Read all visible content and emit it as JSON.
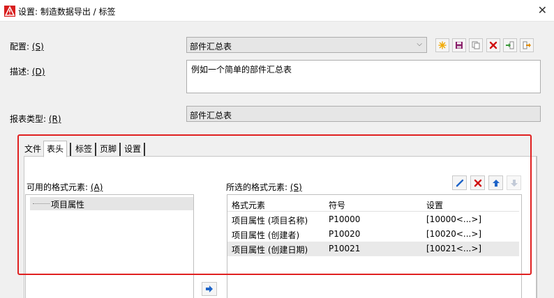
{
  "window": {
    "title": "设置: 制造数据导出 / 标签",
    "close": "✕"
  },
  "config": {
    "label": "配置: ",
    "shortcut": "(S)",
    "value": "部件汇总表",
    "arrow": "⌵"
  },
  "description": {
    "label": "描述: ",
    "shortcut": "(D)",
    "value": "例如一个简单的部件汇总表"
  },
  "report_type": {
    "label": "报表类型: ",
    "shortcut": "(R)",
    "value": "部件汇总表"
  },
  "toolbar": {
    "icons": [
      "new-icon",
      "save-icon",
      "copy-icon",
      "delete-icon",
      "import-icon",
      "export-icon"
    ]
  },
  "tabs": [
    {
      "label": "文件"
    },
    {
      "label": "表头"
    },
    {
      "label": "标签"
    },
    {
      "label": "页脚"
    },
    {
      "label": "设置"
    }
  ],
  "available": {
    "label": "可用的格式元素: ",
    "shortcut": "(A)",
    "items": [
      "项目属性"
    ]
  },
  "selected": {
    "label": "所选的格式元素: ",
    "shortcut": "(S)",
    "columns": [
      "格式元素",
      "符号",
      "设置"
    ],
    "rows": [
      [
        "项目属性 (项目名称)",
        "P10000",
        "[10000<...>]"
      ],
      [
        "项目属性 (创建者)",
        "P10020",
        "[10020<...>]"
      ],
      [
        "项目属性 (创建日期)",
        "P10021",
        "[10021<...>]"
      ]
    ]
  },
  "colors": {
    "accent": "#1e64c8",
    "highlight": "#e02020",
    "delete": "#d01010"
  }
}
